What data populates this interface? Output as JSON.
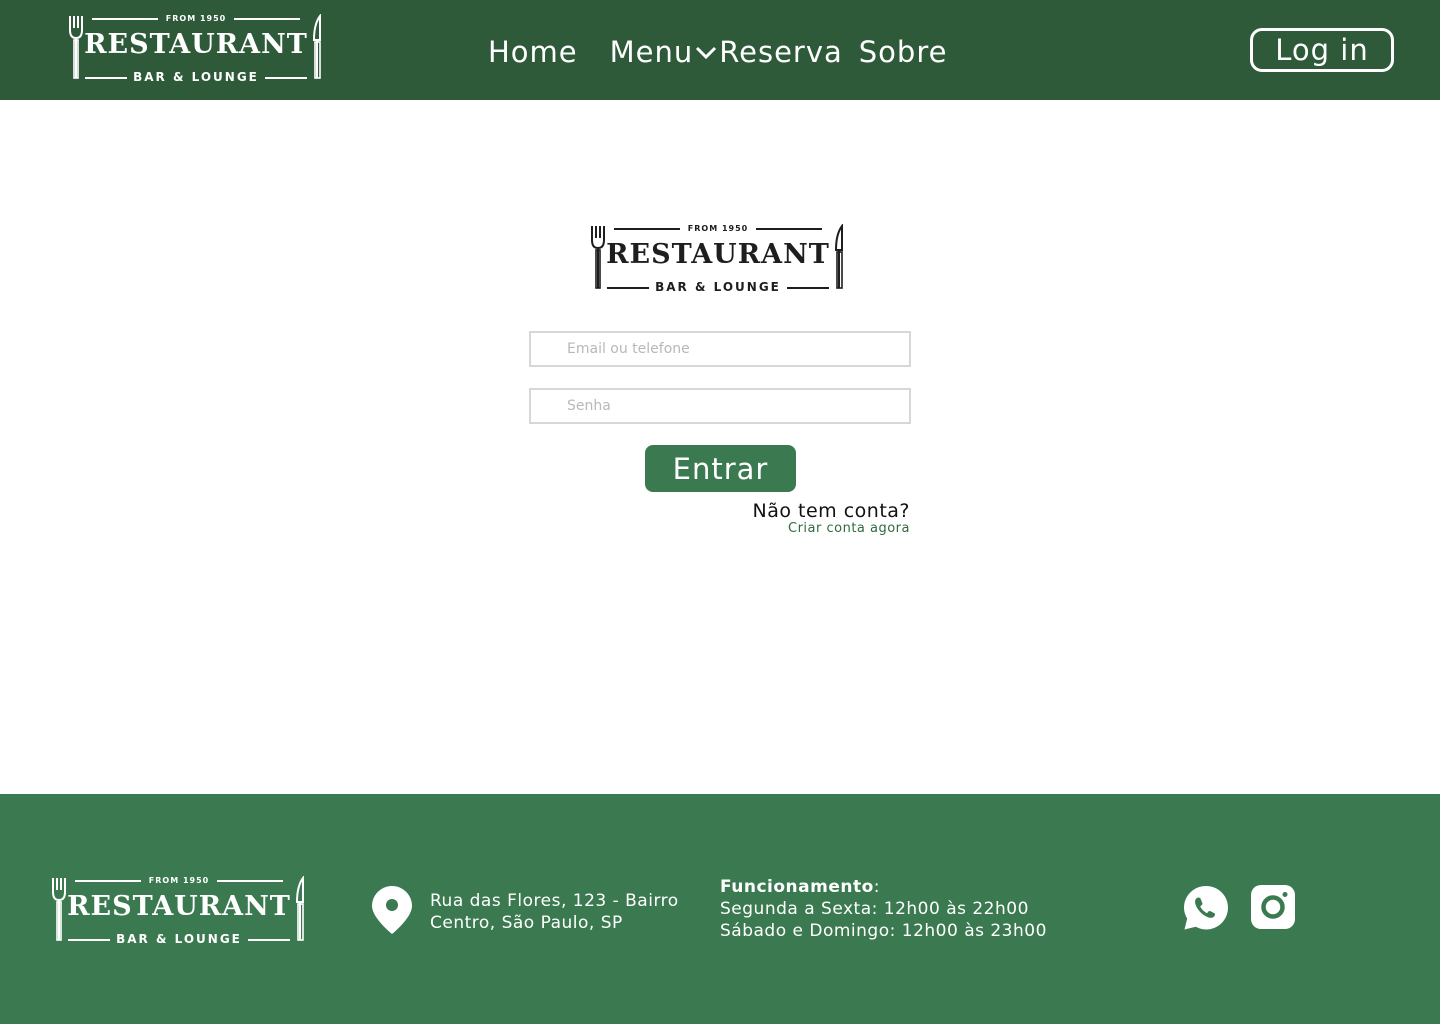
{
  "logo": {
    "from": "FROM 1950",
    "name": "RESTAURANT",
    "sub": "BAR & LOUNGE"
  },
  "nav": {
    "home": "Home",
    "menu": "Menu",
    "reserva": "Reserva",
    "sobre": "Sobre",
    "login": "Log in"
  },
  "login_form": {
    "email_placeholder": "Email ou telefone",
    "password_placeholder": "Senha",
    "submit": "Entrar",
    "no_account": "Não tem conta?",
    "create_account": "Criar conta agora"
  },
  "footer": {
    "address_line1": "Rua das Flores, 123 - Bairro",
    "address_line2": "Centro, São Paulo, SP",
    "hours_label": "Funcionamento",
    "hours_colon": ":",
    "hours_weekdays": "Segunda a Sexta: 12h00 às 22h00",
    "hours_weekend": "Sábado e Domingo: 12h00 às 23h00"
  },
  "colors": {
    "header_bg": "#2e5a3a",
    "footer_bg": "#3b7a50",
    "accent": "#3b7a50",
    "link": "#2e6b3e"
  },
  "icons": [
    "chevron-down-icon",
    "location-pin-icon",
    "whatsapp-icon",
    "instagram-icon",
    "fork-icon",
    "knife-icon"
  ]
}
